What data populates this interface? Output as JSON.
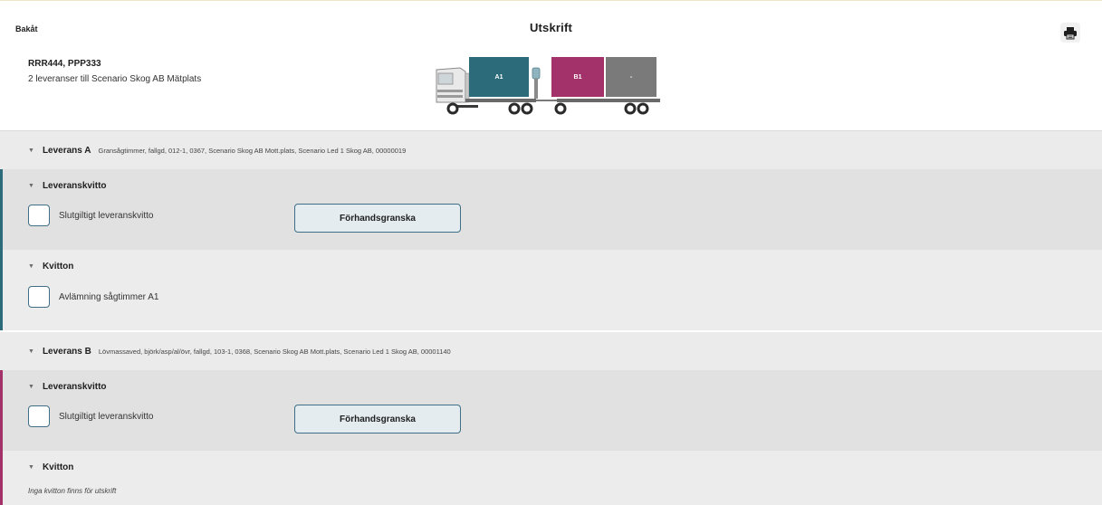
{
  "header": {
    "back_label": "Bakåt",
    "title": "Utskrift",
    "print_icon": "printer-icon",
    "vehicle_ids": "RRR444, PPP333",
    "delivery_summary": "2 leveranser till Scenario Skog AB Mätplats"
  },
  "vehicle": {
    "containers": [
      {
        "label": "A1",
        "color": "#2b6b7a"
      },
      {
        "label": "B1",
        "color": "#a3326b"
      },
      {
        "label": "-",
        "color": "#7a7a7a"
      }
    ]
  },
  "deliveries": [
    {
      "title": "Leverans A",
      "description": "Gransågtimmer, fallgd, 012-1, 0367, Scenario Skog AB Mott.plats, Scenario Led 1 Skog AB, 00000019",
      "accent_color": "#2b6b7a",
      "receipt": {
        "title": "Leveranskvitto",
        "checkbox_label": "Slutgiltigt leveranskvitto",
        "preview_label": "Förhandsgranska"
      },
      "kvitton": {
        "title": "Kvitton",
        "items": [
          "Avlämning sågtimmer A1"
        ]
      }
    },
    {
      "title": "Leverans B",
      "description": "Lövmassaved, björk/asp/al/övr, fallgd, 103-1, 0368, Scenario Skog AB Mott.plats, Scenario Led 1 Skog AB, 00001140",
      "accent_color": "#a3326b",
      "receipt": {
        "title": "Leveranskvitto",
        "checkbox_label": "Slutgiltigt leveranskvitto",
        "preview_label": "Förhandsgranska"
      },
      "kvitton": {
        "title": "Kvitton",
        "empty_text": "Inga kvitton finns för utskrift"
      }
    }
  ]
}
